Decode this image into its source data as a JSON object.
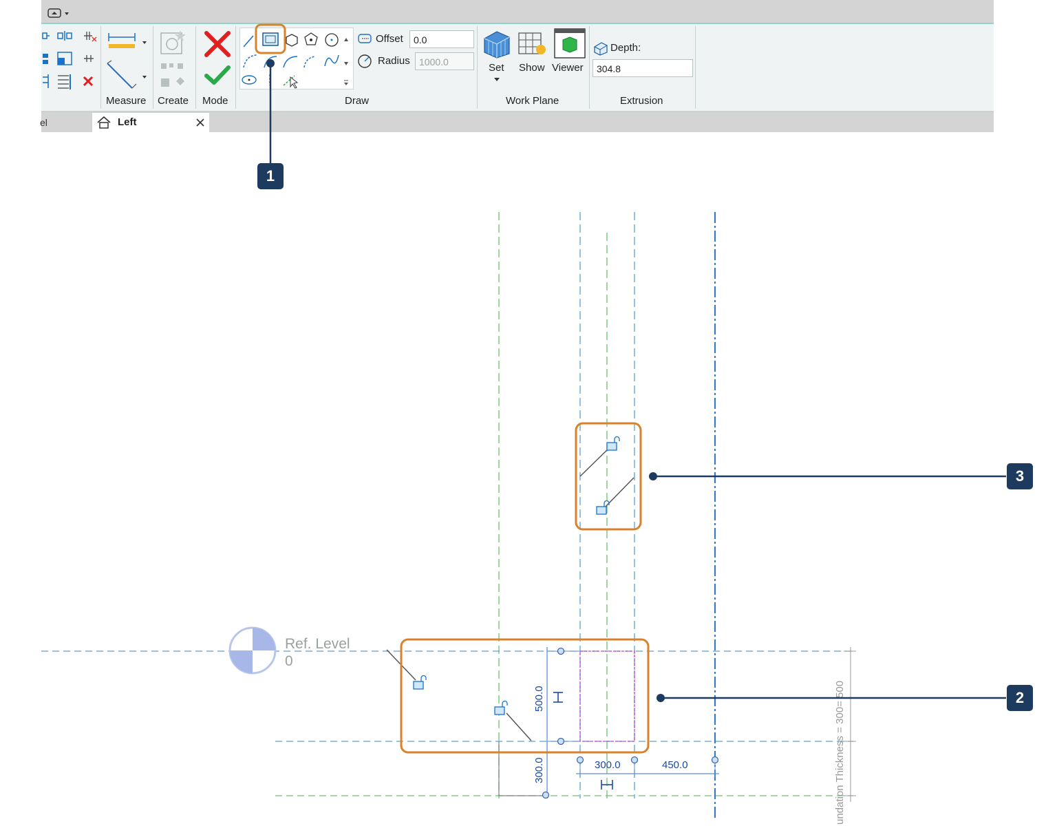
{
  "ribbon": {
    "modify_panel": {
      "measure_label": "Measure",
      "create_label": "Create"
    },
    "mode_panel": {
      "title": "Mode"
    },
    "draw_panel": {
      "title": "Draw",
      "offset_label": "Offset",
      "offset_value": "0.0",
      "radius_label": "Radius",
      "radius_value": "1000.0"
    },
    "work_plane_panel": {
      "title": "Work Plane",
      "set_label": "Set",
      "show_label": "Show",
      "viewer_label": "Viewer"
    },
    "extrusion_panel": {
      "title": "Extrusion",
      "depth_label": "Depth:",
      "depth_value": "304.8"
    }
  },
  "view_tabs": {
    "left_fragment": "el",
    "active_tab": "Left"
  },
  "canvas": {
    "ref_level_name": "Ref. Level",
    "ref_level_value": "0",
    "dim_vertical_500": "500.0",
    "dim_vertical_300": "300.0",
    "dim_horizontal_300": "300.0",
    "dim_horizontal_450": "450.0",
    "foundation_label": "undation Thickness = 300= 500"
  },
  "callouts": [
    "1",
    "2",
    "3"
  ],
  "colors": {
    "highlight": "#d9822b",
    "callout": "#1d3a5f",
    "reference_plane": "#5aa0d0",
    "green_plane": "#6cc070",
    "sketch": "#cc44cc"
  }
}
